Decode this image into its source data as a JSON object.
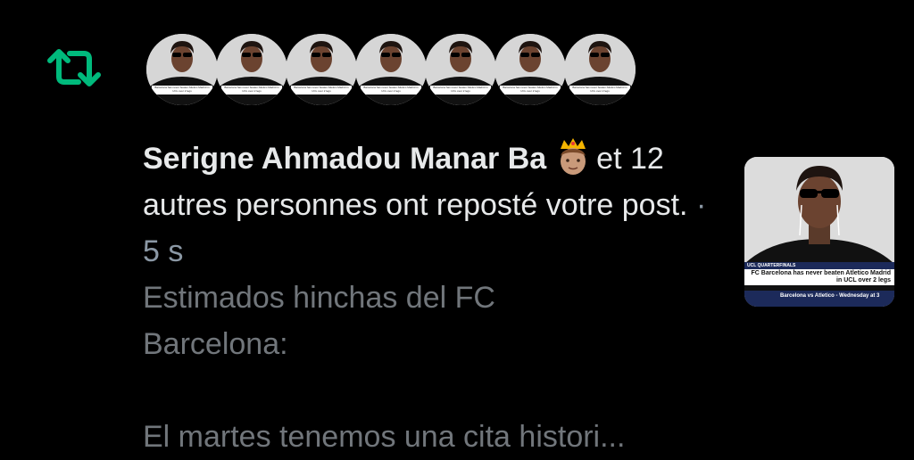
{
  "notification": {
    "icon": "repost-icon",
    "accent_color": "#00ba7c",
    "avatar_count": 7,
    "avatar_caption": "Barcelona has never beaten Atletico Madrid in UCL over 2 legs",
    "name": "Serigne Ahmadou Manar Ba",
    "emoji": "prince-emoji",
    "text_after_name": "et 12 autres personnes ont reposté votre post.",
    "time": "· 5 s",
    "preview_lines": [
      "Estimados hinchas del FC",
      "Barcelona:",
      "",
      "El martes tenemos una cita histori..."
    ]
  },
  "thumbnail": {
    "caption_small": "UCL QUARTERFINALS",
    "caption": "FC Barcelona has never beaten Atletico Madrid in UCL over 2 legs",
    "ticker": "Barcelona vs Atletico - Wednesday at 3"
  }
}
